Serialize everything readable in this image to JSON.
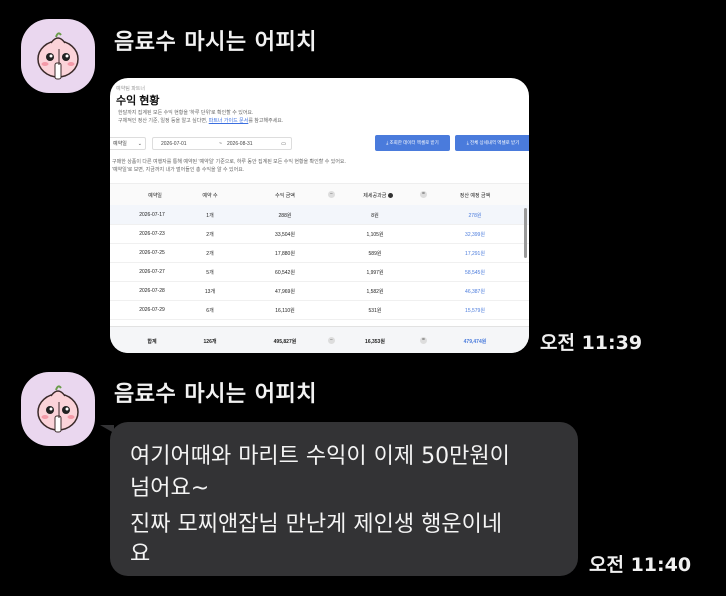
{
  "messages": [
    {
      "sender": "음료수 마시는 어피치",
      "time": "오전 11:39",
      "type": "image"
    },
    {
      "sender": "음료수 마시는 어피치",
      "time": "오전 11:40",
      "type": "text",
      "lines": [
        "여기어때와 마리트 수익이 이제 50만원이",
        "넘어요~",
        "진짜 모찌앤잡님 만난게 제인생 행운이네",
        "요"
      ]
    }
  ],
  "screenshot": {
    "breadcrumb": "예약팀 파트너",
    "title": "수익 현황",
    "desc1": "한달까지 집계된 모든 수익 현황을 '하루 단위'로 확인할 수 있어요.",
    "desc2_prefix": "구체적인 정산 기준, 일정 등을 알고 싶다면, ",
    "desc2_link": "파트너 가이드 문서",
    "desc2_suffix": "를 참고해주세요.",
    "filter_type": "예약일",
    "date_from": "2026-07-01",
    "date_sep": "~",
    "date_to": "2026-08-31",
    "btn_download_view": "조회한 데이터 엑셀로 받기",
    "btn_download_all": "전체 상세내역 엑셀로 받기",
    "note1": "구매한 상품이 다른 여행자를 통해 예약된 '예약일' 기준으로, 하루 동안 집계된 모든 수익 현황을 확인할 수 있어요.",
    "note2": "'예약일'로 보면, 지금까지 내가 벌어들인 총 수익을 알 수 있어요.",
    "columns": [
      "예약일",
      "예약 수",
      "수익 금액",
      "제세공과금",
      "정산 예정 금액"
    ],
    "rows": [
      {
        "date": "2026-07-17",
        "count": "1개",
        "revenue": "288원",
        "tax": "8원",
        "settle": "278원"
      },
      {
        "date": "2026-07-23",
        "count": "2개",
        "revenue": "33,504원",
        "tax": "1,105원",
        "settle": "32,399원"
      },
      {
        "date": "2026-07-25",
        "count": "2개",
        "revenue": "17,880원",
        "tax": "589원",
        "settle": "17,291원"
      },
      {
        "date": "2026-07-27",
        "count": "5개",
        "revenue": "60,542원",
        "tax": "1,997원",
        "settle": "58,545원"
      },
      {
        "date": "2026-07-28",
        "count": "13개",
        "revenue": "47,969원",
        "tax": "1,582원",
        "settle": "46,387원"
      },
      {
        "date": "2026-07-29",
        "count": "6개",
        "revenue": "16,110원",
        "tax": "531원",
        "settle": "15,579원"
      }
    ],
    "total": {
      "label": "합계",
      "count": "126개",
      "revenue": "495,827원",
      "tax": "16,353원",
      "settle": "479,474원"
    },
    "op_minus": "−",
    "op_equals": "="
  },
  "colors": {
    "background": "#000000",
    "bubble": "#333335",
    "avatar_bg": "#ead7ef",
    "link_blue": "#4a7bdc"
  }
}
